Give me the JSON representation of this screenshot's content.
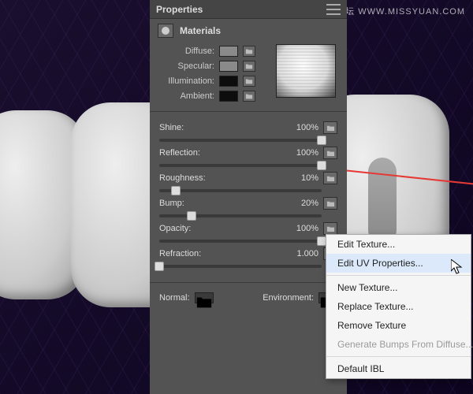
{
  "watermark": "思缘设计论坛  WWW.MISSYUAN.COM",
  "panel": {
    "title": "Properties",
    "section": "Materials",
    "color_rows": [
      {
        "label": "Diffuse:",
        "swatch": "#8a8a8a"
      },
      {
        "label": "Specular:",
        "swatch": "#8a8a8a"
      },
      {
        "label": "Illumination:",
        "swatch": "#0d0d0d"
      },
      {
        "label": "Ambient:",
        "swatch": "#0d0d0d"
      }
    ],
    "sliders": [
      {
        "label": "Shine:",
        "value": "100%",
        "pos": 100
      },
      {
        "label": "Reflection:",
        "value": "100%",
        "pos": 100
      },
      {
        "label": "Roughness:",
        "value": "10%",
        "pos": 10
      },
      {
        "label": "Bump:",
        "value": "20%",
        "pos": 20
      },
      {
        "label": "Opacity:",
        "value": "100%",
        "pos": 100
      },
      {
        "label": "Refraction:",
        "value": "1.000",
        "pos": 0
      }
    ],
    "bottom": {
      "normal": "Normal:",
      "env": "Environment:"
    }
  },
  "context_menu": {
    "items": [
      {
        "label": "Edit Texture...",
        "enabled": true
      },
      {
        "label": "Edit UV Properties...",
        "enabled": true,
        "highlight": true
      },
      {
        "sep": true
      },
      {
        "label": "New Texture...",
        "enabled": true
      },
      {
        "label": "Replace Texture...",
        "enabled": true
      },
      {
        "label": "Remove Texture",
        "enabled": true
      },
      {
        "label": "Generate Bumps From Diffuse...",
        "enabled": false
      },
      {
        "sep": true
      },
      {
        "label": "Default IBL",
        "enabled": true
      }
    ]
  }
}
